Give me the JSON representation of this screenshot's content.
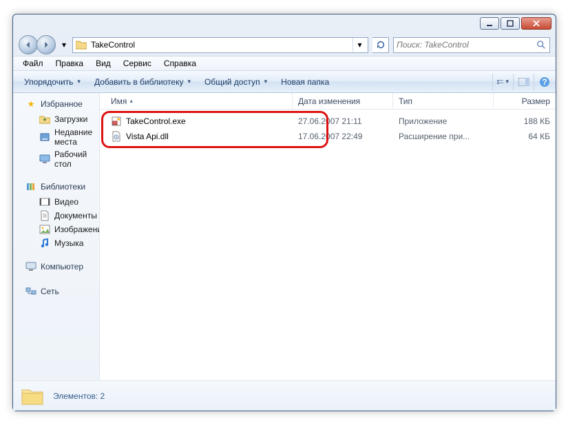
{
  "titlebar": {
    "minimize": "",
    "maximize": "",
    "close": ""
  },
  "nav": {
    "address_folder": "TakeControl",
    "search_placeholder": "Поиск: TakeControl"
  },
  "menubar": {
    "file": "Файл",
    "edit": "Правка",
    "view": "Вид",
    "tools": "Сервис",
    "help": "Справка"
  },
  "toolbar": {
    "organize": "Упорядочить",
    "include": "Добавить в библиотеку",
    "share": "Общий доступ",
    "newfolder": "Новая папка"
  },
  "sidebar": {
    "favorites": "Избранное",
    "fav_items": {
      "downloads": "Загрузки",
      "recent": "Недавние места",
      "desktop": "Рабочий стол"
    },
    "libraries": "Библиотеки",
    "lib_items": {
      "videos": "Видео",
      "documents": "Документы",
      "pictures": "Изображения",
      "music": "Музыка"
    },
    "computer": "Компьютер",
    "network": "Сеть"
  },
  "columns": {
    "name": "Имя",
    "date": "Дата изменения",
    "type": "Тип",
    "size": "Размер"
  },
  "files": [
    {
      "name": "TakeControl.exe",
      "date": "27.06.2007 21:11",
      "type": "Приложение",
      "size": "188 КБ"
    },
    {
      "name": "Vista Api.dll",
      "date": "17.06.2007 22:49",
      "type": "Расширение при...",
      "size": "64 КБ"
    }
  ],
  "statusbar": {
    "count_label": "Элементов: 2"
  }
}
